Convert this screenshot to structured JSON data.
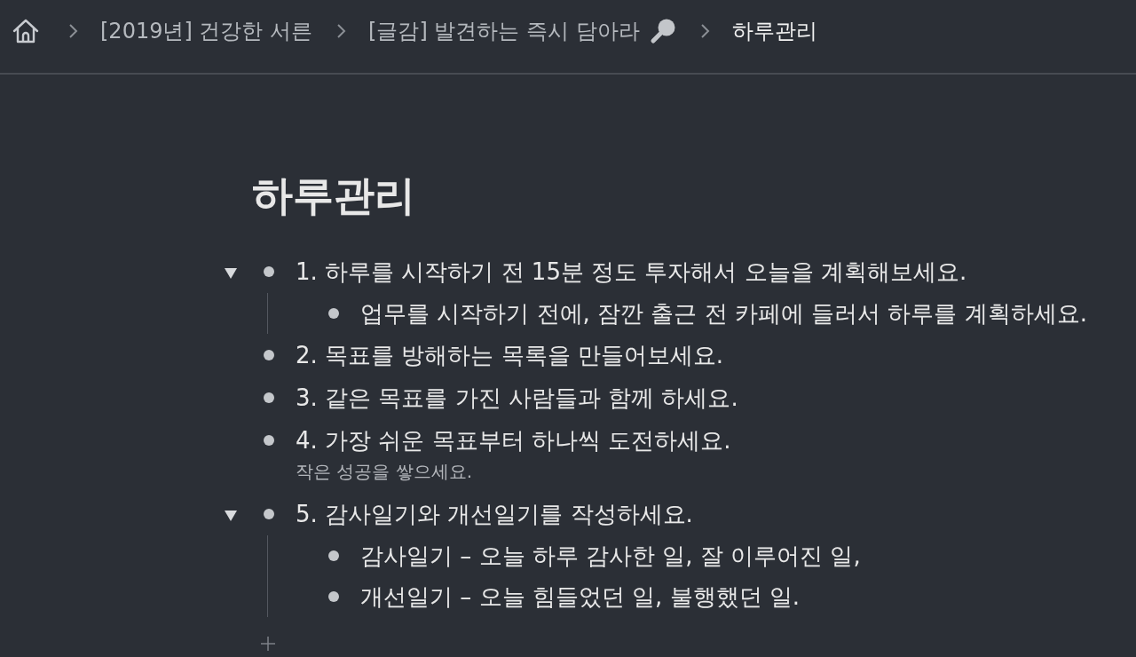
{
  "breadcrumb": [
    {
      "label": "[2019년] 건강한 서른",
      "current": false
    },
    {
      "label": "[글감] 발견하는 즉시 담아라",
      "current": false,
      "icon": true
    },
    {
      "label": "하루관리",
      "current": true
    }
  ],
  "title": "하루관리",
  "items": [
    {
      "text": "1. 하루를 시작하기 전 15분 정도 투자해서 오늘을 계획해보세요.",
      "expanded": true,
      "children": [
        {
          "text": "업무를 시작하기 전에, 잠깐 출근 전 카페에 들러서 하루를 계획하세요."
        }
      ]
    },
    {
      "text": "2. 목표를 방해하는 목록을 만들어보세요."
    },
    {
      "text": "3. 같은 목표를 가진 사람들과 함께 하세요."
    },
    {
      "text": "4. 가장 쉬운 목표부터 하나씩 도전하세요.",
      "note": "작은 성공을 쌓으세요."
    },
    {
      "text": "5. 감사일기와 개선일기를 작성하세요.",
      "expanded": true,
      "children": [
        {
          "text": "감사일기 – 오늘 하루 감사한 일, 잘 이루어진 일,"
        },
        {
          "text": "개선일기 – 오늘 힘들었던 일, 불행했던 일."
        }
      ]
    }
  ]
}
